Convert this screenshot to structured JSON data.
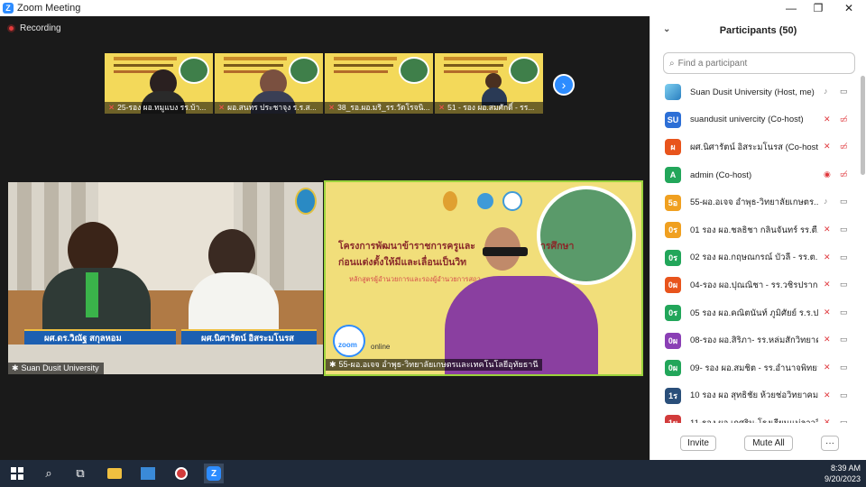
{
  "window": {
    "title": "Zoom Meeting",
    "minimize": "—",
    "restore": "❐",
    "close": "✕"
  },
  "meeting": {
    "recording_label": "Recording",
    "strip": [
      {
        "name": "25-รอง ผอ.ทมูแบง รร.บ้า..."
      },
      {
        "name": "ผอ.สนทร ประชาจุง ร.ร.ส..."
      },
      {
        "name": "38_รอ.ผอ.มริ_รร.วัดโรจนิ..."
      },
      {
        "name": "51 - รอง ผอ.สมศักดิ์ - รร..."
      }
    ],
    "next_arrow": "›",
    "tile_a": {
      "nameplate_left": "ผศ.ดร.วิณัฐ สกุลหอม",
      "nameplate_right": "ผศ.นิศารัตน์ อิสระมโนรส",
      "label": "Suan Dusit University"
    },
    "tile_b": {
      "title_line1": "โครงการพัฒนาข้าราชการครูและ",
      "title_line1_end": "ารศึกษา",
      "title_line2": "ก่อนแต่งตั้งให้มีและเลื่อนเป็นวิท",
      "title_line3": "หลักสูตรผู้อำนวยการและรองผู้อำนวยการสถา",
      "zoom_tag": "zoom",
      "online_tag": "online",
      "label": "55-ผอ.อเจจ อำพุธ-วิทยาลัยเกษตรและเทคโนโลยีอุทัยธานี"
    }
  },
  "participants": {
    "title": "Participants (50)",
    "search_placeholder": "Find a participant",
    "items": [
      {
        "initials": "",
        "name": "Suan Dusit University (Host, me)",
        "color": "#4aa3df",
        "mic": "on",
        "cam": "off"
      },
      {
        "initials": "SU",
        "name": "suandusit univercity (Co-host)",
        "color": "#2d6fd6",
        "mic": "muted",
        "cam": "muted"
      },
      {
        "initials": "ผ",
        "name": "ผศ.นิศารัตน์ อิสระมโนรส (Co-host)",
        "color": "#e8541c",
        "mic": "muted",
        "cam": "muted"
      },
      {
        "initials": "A",
        "name": "admin (Co-host)",
        "color": "#22a65a",
        "mic": "share",
        "cam": "muted"
      },
      {
        "initials": "5อ",
        "name": "55-ผอ.อเจจ อำพุธ-วิทยาลัยเกษตร...",
        "color": "#f0a020",
        "mic": "on",
        "cam": "off"
      },
      {
        "initials": "0ร",
        "name": "01 รอง ผอ.ชลธิชา กลินจันทร์ รร.ตี...",
        "color": "#f0a020",
        "mic": "muted",
        "cam": "off"
      },
      {
        "initials": "0ร",
        "name": "02 รอง ผอ.กฤษณกรณ์ บัวลี - รร.ต...",
        "color": "#22a65a",
        "mic": "muted",
        "cam": "off"
      },
      {
        "initials": "0ผ",
        "name": "04-รอง ผอ.ปุณณิชา - รร.วชิรปราก...",
        "color": "#e8541c",
        "mic": "muted",
        "cam": "off"
      },
      {
        "initials": "0ร",
        "name": "05 รอง ผอ.คณิตนันท์ ภูมิศัยย์ ร.ร.ป...",
        "color": "#22a65a",
        "mic": "muted",
        "cam": "off"
      },
      {
        "initials": "0ผ",
        "name": "08-รอง ผอ.สิริภา- รร.หล่มสักวิทยาคม",
        "color": "#8a3fb5",
        "mic": "muted",
        "cam": "off"
      },
      {
        "initials": "0ผ",
        "name": "09- รอง ผอ.สมชิต - รร.อำนาจพิทยาคม...",
        "color": "#22a65a",
        "mic": "muted",
        "cam": "off"
      },
      {
        "initials": "1ร",
        "name": "10 รอง ผอ สุทธิชัย ห้วยช่อวิทยาคม ร...",
        "color": "#2a4f7a",
        "mic": "muted",
        "cam": "off"
      },
      {
        "initials": "1ผ",
        "name": "11-รอง ผอ.เกศริน-โรงเรียนแม่ลาววิ...",
        "color": "#d23b3b",
        "mic": "muted",
        "cam": "off"
      }
    ],
    "invite_label": "Invite",
    "mute_all_label": "Mute All",
    "more_label": "···"
  },
  "taskbar": {
    "time": "8:39 AM",
    "date": "9/20/2023"
  },
  "colors": {
    "zoom_blue": "#2d8cff",
    "muted_red": "#e0393e",
    "panel_bg": "#ffffff"
  }
}
